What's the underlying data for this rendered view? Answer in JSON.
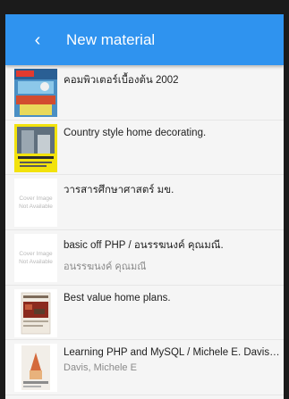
{
  "appbar": {
    "back_icon": "chevron-left-icon",
    "title": "New material"
  },
  "items": [
    {
      "title": "คอมพิวเตอร์เบื้องต้น 2002",
      "subtitle": "",
      "cover": "book-cover-computer"
    },
    {
      "title": "Country style home decorating.",
      "subtitle": "",
      "cover": "book-cover-house"
    },
    {
      "title": "วารสารศึกษาศาสตร์ มข.",
      "subtitle": "",
      "cover": "cover-not-available"
    },
    {
      "title": "basic off PHP / อนรรฆนงค์ คุณมณี.",
      "subtitle": "อนรรฆนงค์ คุณมณี",
      "cover": "cover-not-available"
    },
    {
      "title": "Best value home plans.",
      "subtitle": "",
      "cover": "book-cover-plans"
    },
    {
      "title": "Learning PHP and MySQL / Michele E. Davis ...",
      "subtitle": "Davis, Michele E",
      "cover": "book-cover-php"
    }
  ],
  "placeholder": {
    "line1": "Cover Image",
    "line2": "Not Available"
  }
}
